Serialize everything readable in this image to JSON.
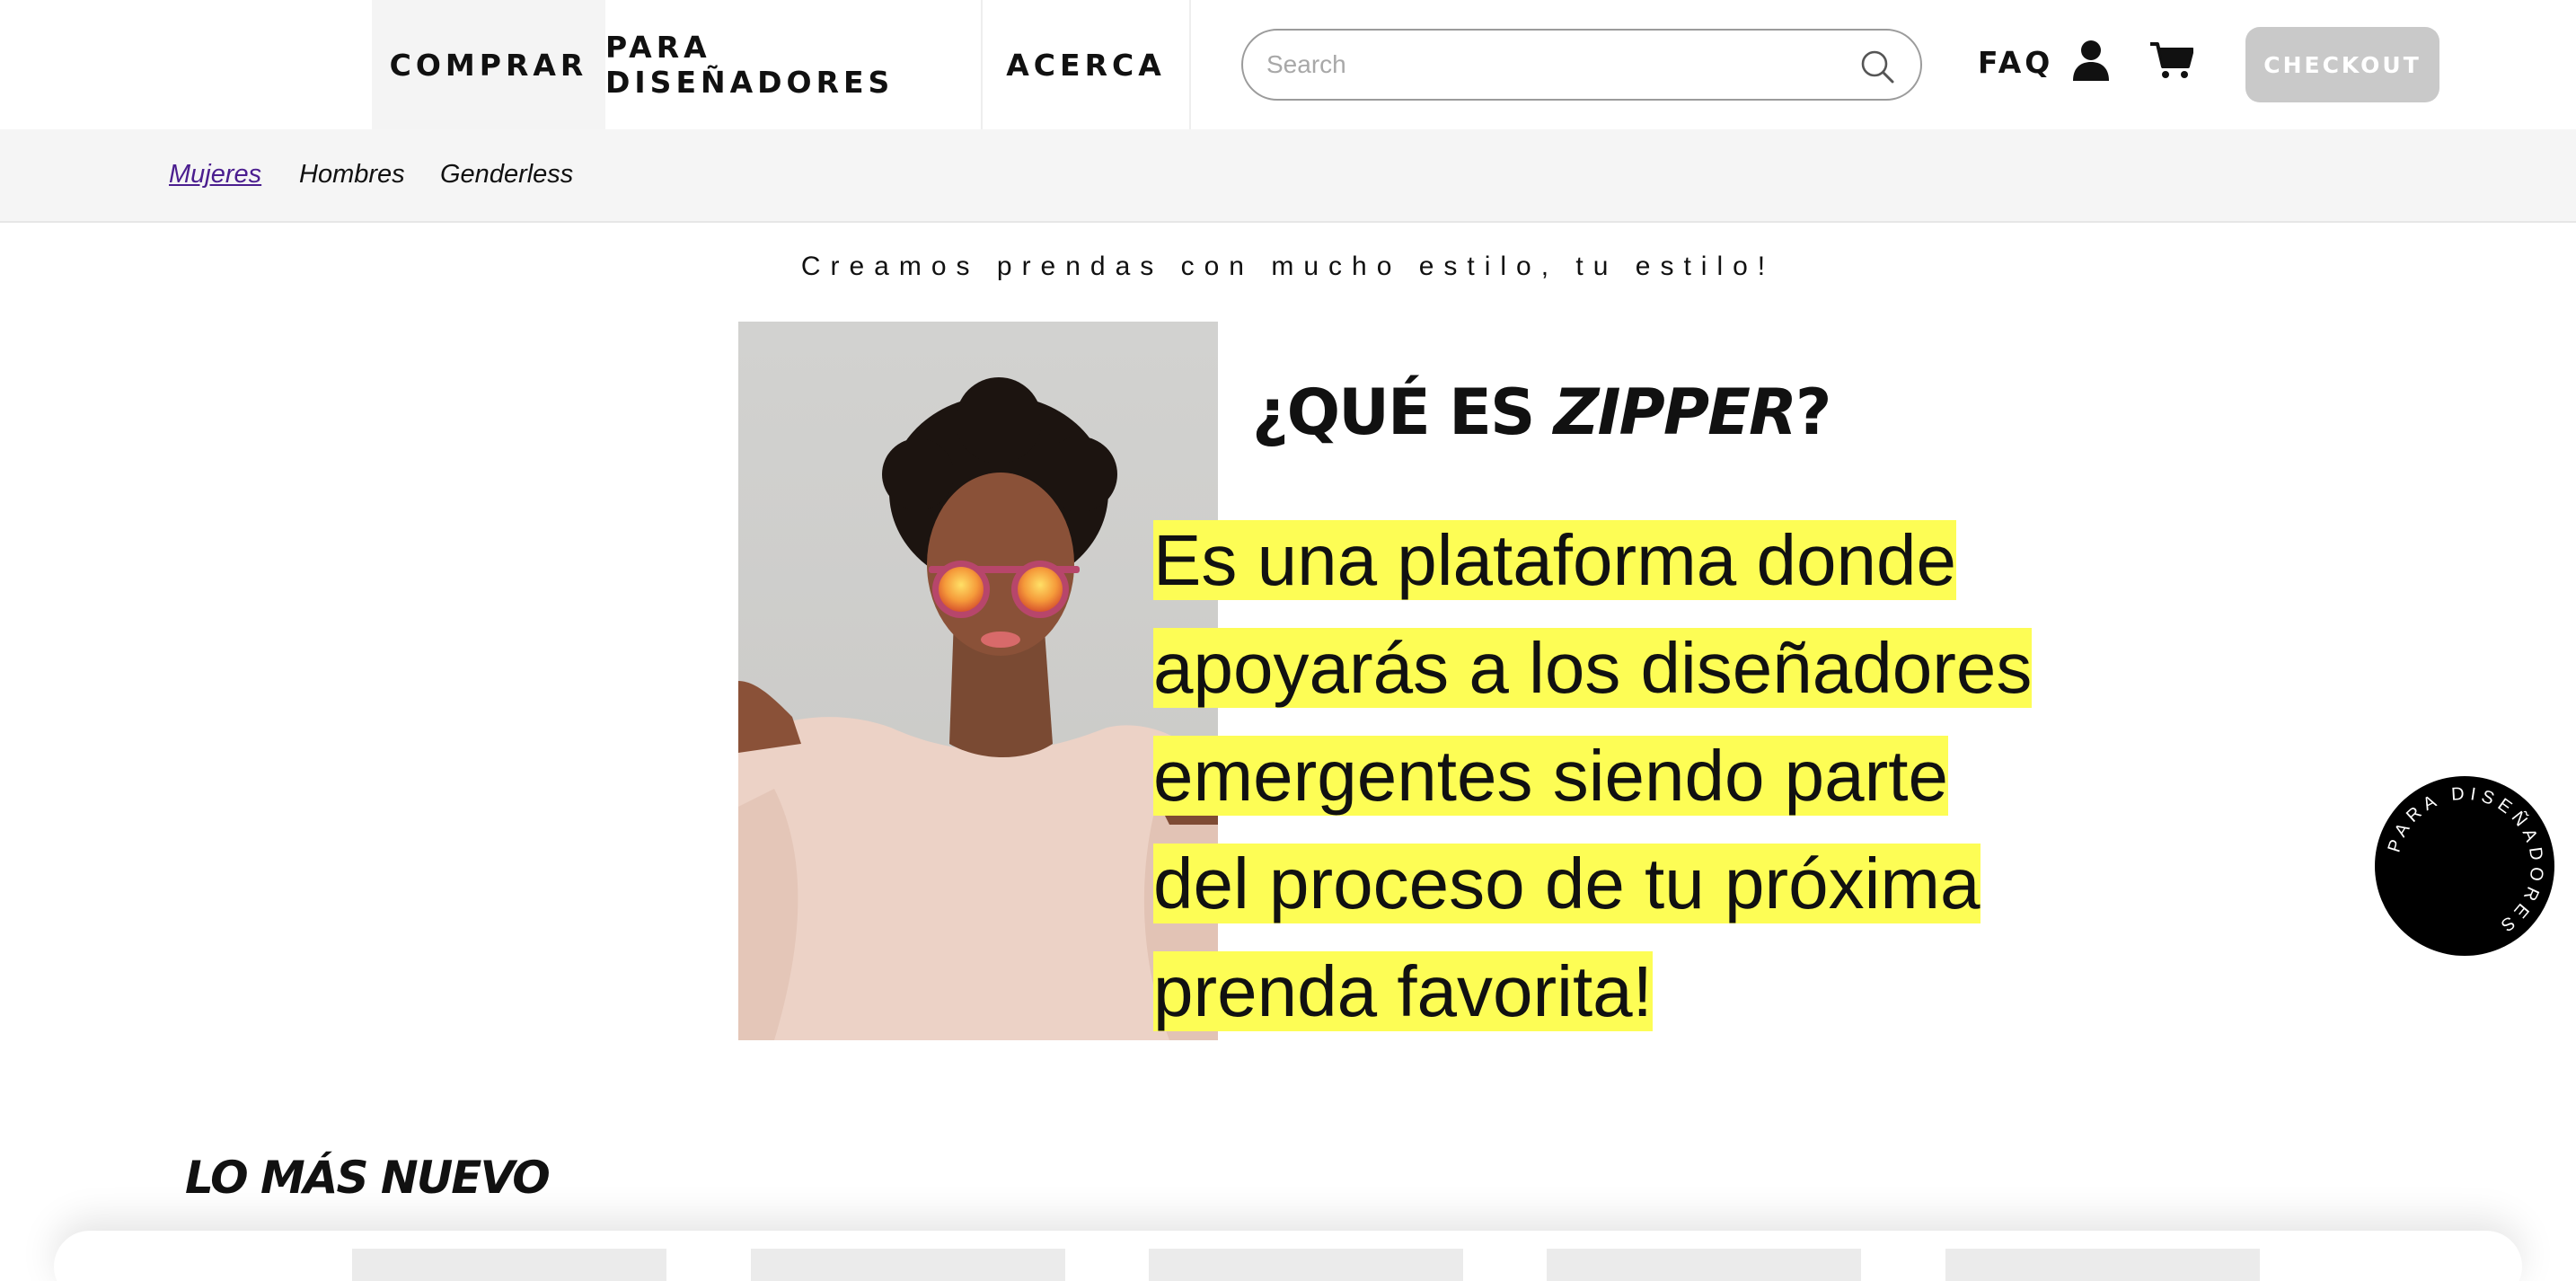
{
  "nav": {
    "tabs": [
      {
        "label": "COMPRAR",
        "active": true
      },
      {
        "label": "PARA DISEÑADORES",
        "active": false
      },
      {
        "label": "ACERCA",
        "active": false
      }
    ],
    "search_placeholder": "Search",
    "faq_label": "FAQ",
    "icons": {
      "search": "search-icon",
      "user": "user-icon",
      "cart": "cart-icon"
    },
    "checkout_label": "CHECKOUT"
  },
  "subnav": {
    "links": [
      {
        "label": "Mujeres",
        "active": true
      },
      {
        "label": "Hombres",
        "active": false
      },
      {
        "label": "Genderless",
        "active": false
      }
    ]
  },
  "hero": {
    "tagline": "Creamos prendas con mucho estilo, tu estilo!",
    "title_prefix": "¿QUÉ ES ",
    "title_brand": "ZIPPER",
    "title_suffix": "?",
    "description_lines": [
      "Es una plataforma donde",
      "apoyarás a los diseñadores",
      "emergentes siendo parte",
      "del proceso de tu próxima",
      "prenda favorita!"
    ]
  },
  "badge": {
    "text": "PARA DISEÑADORES"
  },
  "newest": {
    "title": "LO MÁS NUEVO",
    "product_count": 5
  },
  "colors": {
    "highlight": "#fdfd55",
    "active_link": "#4b1e8f",
    "checkout_bg": "#c9c9c9",
    "nav_active_bg": "#f4f4f4",
    "badge_bg": "#000000"
  }
}
